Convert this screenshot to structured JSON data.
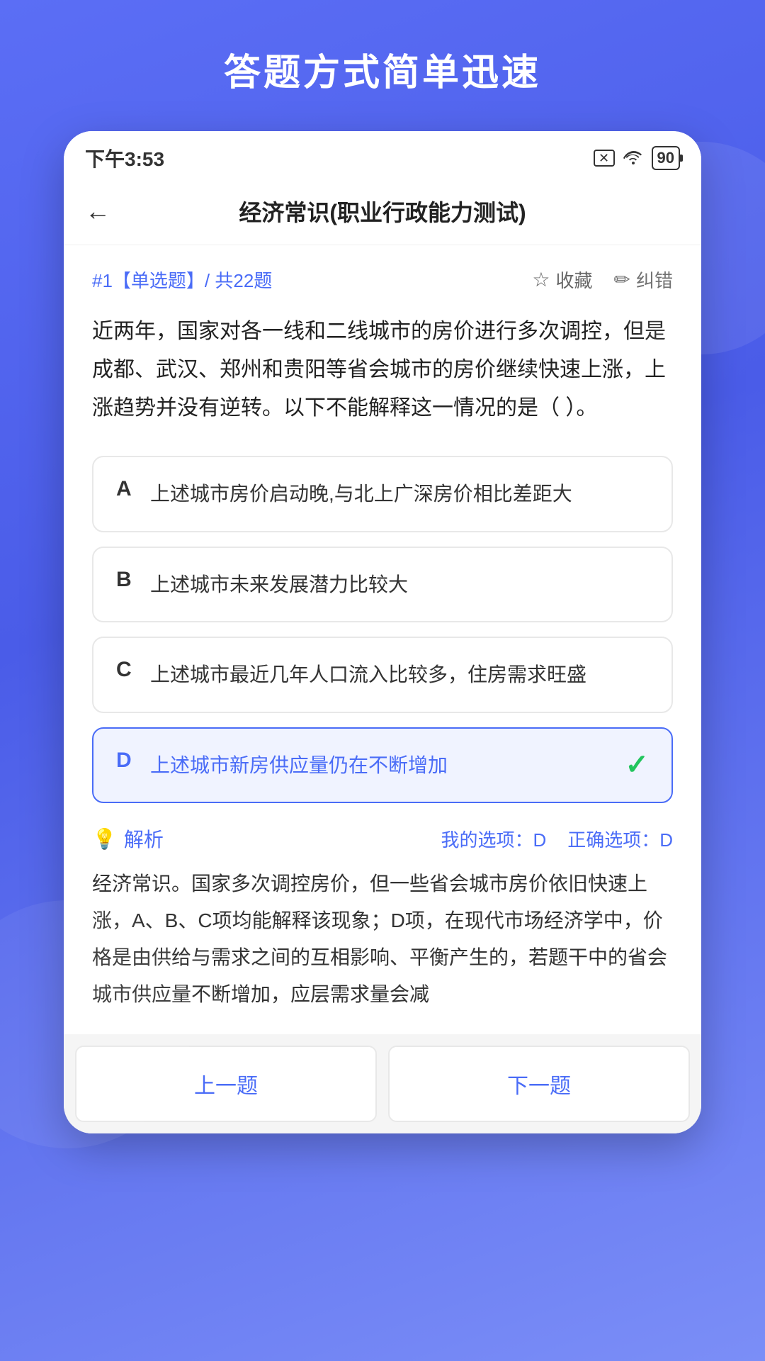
{
  "page": {
    "title": "答题方式简单迅速"
  },
  "statusBar": {
    "time": "下午3:53",
    "battery": "90",
    "icons": {
      "close": "×",
      "wifi": "wifi",
      "battery": "battery"
    }
  },
  "nav": {
    "backArrow": "←",
    "title": "经济常识(职业行政能力测试)"
  },
  "question": {
    "label": "#1【单选题】/ 共22题",
    "collectLabel": "收藏",
    "correctLabel": "纠错",
    "text": "近两年，国家对各一线和二线城市的房价进行多次调控，但是成都、武汉、郑州和贵阳等省会城市的房价继续快速上涨，上涨趋势并没有逆转。以下不能解释这一情况的是（  ）。"
  },
  "options": [
    {
      "letter": "A",
      "text": "上述城市房价启动晚,与北上广深房价相比差距大",
      "isCorrect": false
    },
    {
      "letter": "B",
      "text": "上述城市未来发展潜力比较大",
      "isCorrect": false
    },
    {
      "letter": "C",
      "text": "上述城市最近几年人口流入比较多，住房需求旺盛",
      "isCorrect": false
    },
    {
      "letter": "D",
      "text": "上述城市新房供应量仍在不断增加",
      "isCorrect": true
    }
  ],
  "analysis": {
    "iconLabel": "解析",
    "myAnswerLabel": "我的选项：D",
    "correctAnswerLabel": "正确选项：D",
    "text": "经济常识。国家多次调控房价，但一些省会城市房价依旧快速上涨，A、B、C项均能解释该现象；D项，在现代市场经济学中，价格是由供给与需求之间的互相影响、平衡产生的，若题干中的省会城市供应量不断增加，应层需求量会减"
  },
  "bottomNav": {
    "prevLabel": "上一题",
    "nextLabel": "下一题"
  }
}
